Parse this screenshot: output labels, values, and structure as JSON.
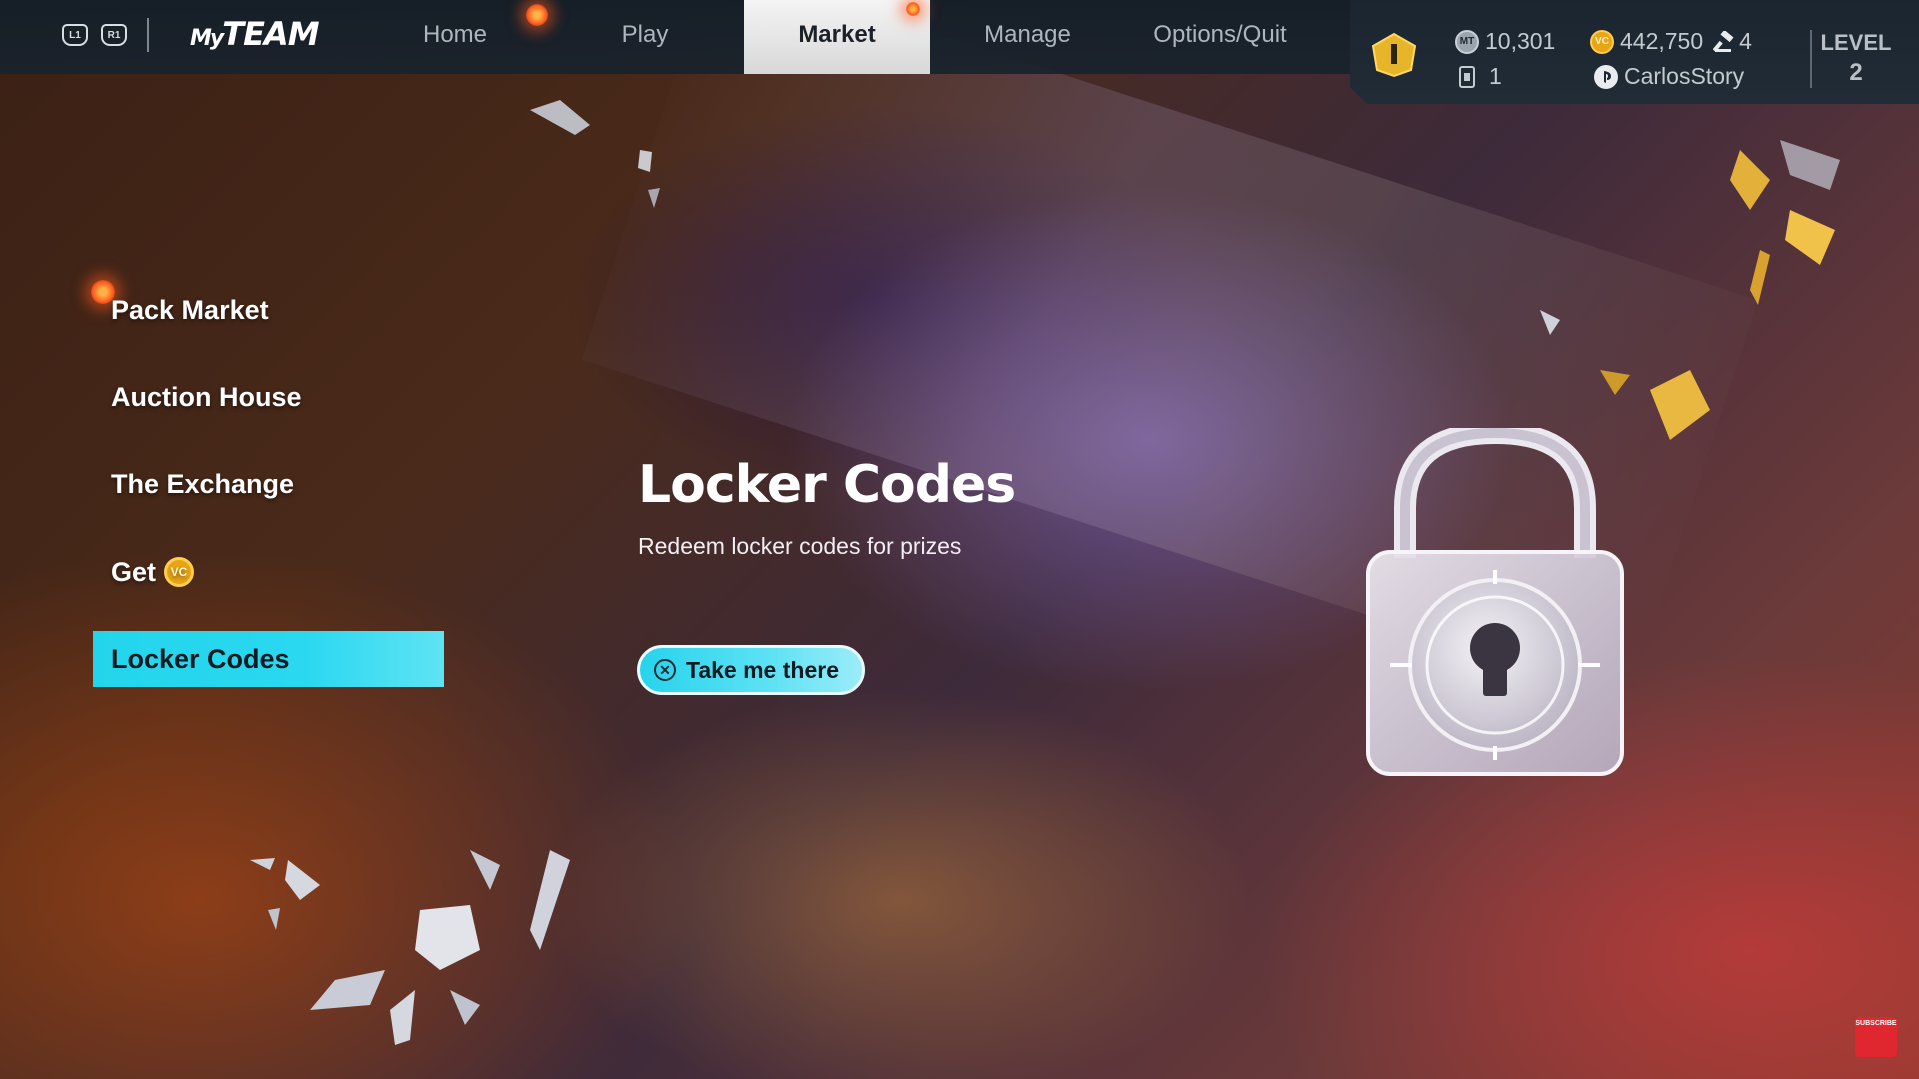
{
  "topbar": {
    "bumper_left": "L1",
    "bumper_right": "R1",
    "logo_my": "My",
    "logo_team": "TEAM",
    "tabs": [
      {
        "label": "Home"
      },
      {
        "label": "Play"
      },
      {
        "label": "Market"
      },
      {
        "label": "Manage"
      },
      {
        "label": "Options/Quit"
      }
    ],
    "active_tab": "Market"
  },
  "status": {
    "rank_icon": "rank-badge-icon",
    "mt_coin_label": "MT",
    "mt_balance": "10,301",
    "vc_coin_label": "VC",
    "vc_balance": "442,750",
    "auction_count": "4",
    "tickets": "1",
    "username": "CarlosStory",
    "level_label": "LEVEL",
    "level_value": "2"
  },
  "menu": {
    "items": [
      {
        "label": "Pack Market"
      },
      {
        "label": "Auction House"
      },
      {
        "label": "The Exchange"
      },
      {
        "label": "Get",
        "coin_label": "VC"
      },
      {
        "label": "Locker Codes"
      }
    ],
    "active_item": "Locker Codes"
  },
  "content": {
    "title": "Locker Codes",
    "subtitle": "Redeem locker codes for prizes",
    "button_label": "Take me there",
    "button_glyph": "✕"
  },
  "overlay": {
    "subscribe_label": "SUBSCRIBE"
  },
  "colors": {
    "accent_cyan": "#23d5ec",
    "topbar_bg": "#18222c",
    "vc_gold": "#e8a516",
    "notification_orange": "#ff5a1f"
  }
}
